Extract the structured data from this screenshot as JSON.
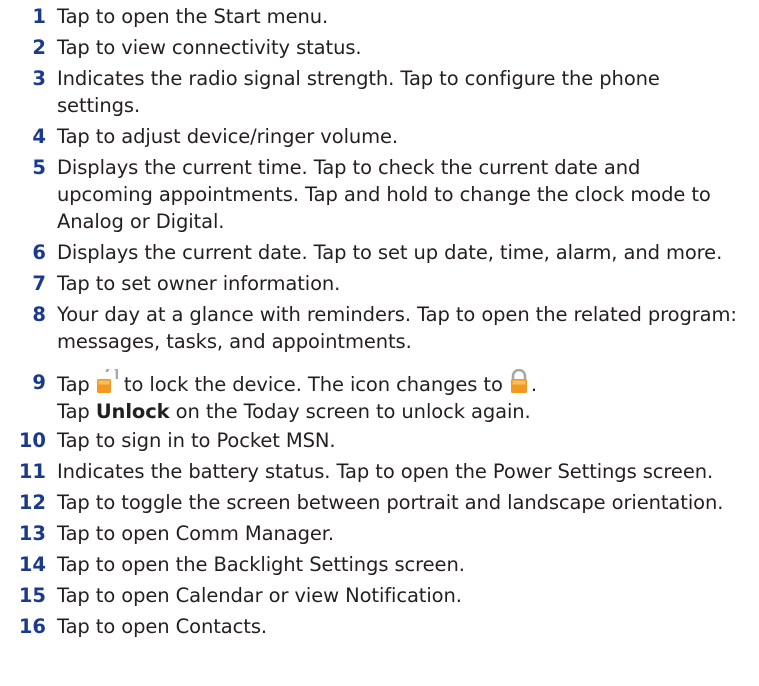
{
  "items": [
    {
      "number": "1",
      "lines": [
        "Tap to open the Start menu."
      ]
    },
    {
      "number": "2",
      "lines": [
        "Tap to view connectivity status."
      ]
    },
    {
      "number": "3",
      "lines": [
        "Indicates the radio signal strength. Tap to configure the phone",
        "settings."
      ]
    },
    {
      "number": "4",
      "lines": [
        "Tap to adjust device/ringer volume."
      ]
    },
    {
      "number": "5",
      "lines": [
        "Displays the current time. Tap to check the current date and",
        "upcoming appointments. Tap and hold to change the clock mode to",
        "Analog or Digital."
      ]
    },
    {
      "number": "6",
      "lines": [
        "Displays the current date. Tap to set up date, time, alarm, and more."
      ]
    },
    {
      "number": "7",
      "lines": [
        "Tap to set owner information."
      ]
    },
    {
      "number": "8",
      "lines": [
        "Your day at a glance with reminders. Tap to open the related program:",
        "messages, tasks, and appointments."
      ]
    },
    {
      "number": "9",
      "line1_a": "Tap ",
      "line1_b": " to lock the device. The icon changes to ",
      "line1_c": ".",
      "line2_a": "Tap ",
      "line2_bold": "Unlock",
      "line2_b": " on the Today screen to unlock again."
    },
    {
      "number": "10",
      "lines": [
        "Tap to sign in to Pocket MSN."
      ]
    },
    {
      "number": "11",
      "lines": [
        "Indicates the battery status. Tap to open the Power Settings screen."
      ]
    },
    {
      "number": "12",
      "lines": [
        "Tap to toggle the screen between portrait and landscape orientation."
      ]
    },
    {
      "number": "13",
      "lines": [
        "Tap to open Comm Manager."
      ]
    },
    {
      "number": "14",
      "lines": [
        "Tap to open the Backlight Settings screen."
      ]
    },
    {
      "number": "15",
      "lines": [
        "Tap to open Calendar or view Notification."
      ]
    },
    {
      "number": "16",
      "lines": [
        "Tap to open Contacts."
      ]
    }
  ],
  "icons": {
    "unlocked": "padlock-open-icon",
    "locked": "padlock-closed-icon"
  },
  "colors": {
    "number": "#1c3a8c",
    "text": "#231f20",
    "lock_body": "#f29a1f",
    "lock_shackle": "#b5b5b5"
  }
}
